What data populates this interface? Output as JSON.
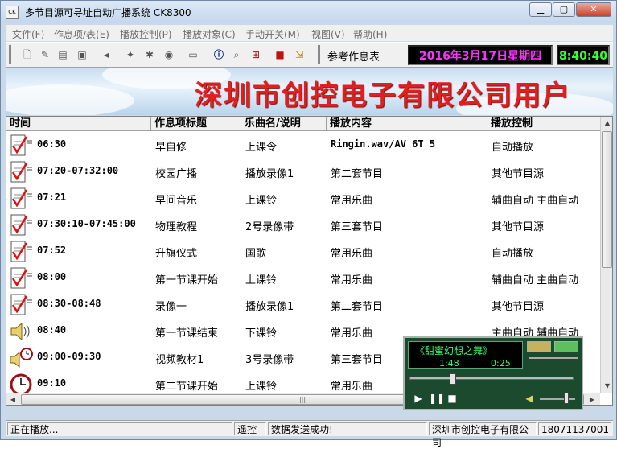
{
  "window": {
    "title": "多节目源可寻址自动广播系统 CK8300",
    "icon_text": "CK"
  },
  "menu": [
    "文件(F)",
    "作息项/表(E)",
    "播放控制(P)",
    "播放对象(C)",
    "手动开关(M)",
    "视图(V)",
    "帮助(H)"
  ],
  "toolbar": {
    "icons": [
      "new-file-icon",
      "edit-icon",
      "properties-icon",
      "save-icon",
      "mute-icon",
      "tool-icon",
      "settings-icon",
      "tape-icon",
      "keyboard-icon",
      "info-icon",
      "find-icon",
      "network-icon",
      "book-icon",
      "exit-icon"
    ],
    "schedule_label": "参考作息表",
    "date": "2016年3月17日星期四",
    "time": "8:40:40"
  },
  "banner": {
    "text": "深圳市创控电子有限公司用户",
    "bg_color": "#c8dff2",
    "text_color": "#e02020"
  },
  "table": {
    "headers": [
      "时间",
      "作息项标题",
      "乐曲名/说明",
      "播放内容",
      "播放控制"
    ],
    "rows": [
      {
        "icon": "schedule-check-icon",
        "time": "06:30",
        "title": "早自修",
        "music": "上课令",
        "content": "Ringin.wav/AV 6T 5",
        "control": "自动播放"
      },
      {
        "icon": "schedule-check-icon",
        "time": "07:20-07:32:00",
        "title": "校园广播",
        "music": "播放录像1",
        "content": "第二套节目",
        "control": "其他节目源"
      },
      {
        "icon": "schedule-check-icon",
        "time": "07:21",
        "title": "早间音乐",
        "music": "上课铃",
        "content": "常用乐曲",
        "control": "辅曲自动 主曲自动"
      },
      {
        "icon": "schedule-check-icon",
        "time": "07:30:10-07:45:00",
        "title": "物理教程",
        "music": "2号录像带",
        "content": "第三套节目",
        "control": "其他节目源"
      },
      {
        "icon": "schedule-check-icon",
        "time": "07:52",
        "title": "升旗仪式",
        "music": "国歌",
        "content": "常用乐曲",
        "control": "自动播放"
      },
      {
        "icon": "schedule-check-icon",
        "time": "08:00",
        "title": "第一节课开始",
        "music": "上课铃",
        "content": "常用乐曲",
        "control": "辅曲自动 主曲自动"
      },
      {
        "icon": "schedule-check-icon",
        "time": "08:30-08:48",
        "title": "录像一",
        "music": "播放录像1",
        "content": "第二套节目",
        "control": "其他节目源"
      },
      {
        "icon": "speaker-icon",
        "time": "08:40",
        "title": "第一节课结束",
        "music": "下课铃",
        "content": "常用乐曲",
        "control": "主曲自动 辅曲自动"
      },
      {
        "icon": "speaker-clock-icon",
        "time": "09:00-09:30",
        "title": "视频教材1",
        "music": "3号录像带",
        "content": "第三套节目",
        "control": ""
      },
      {
        "icon": "clock-icon",
        "time": "09:10",
        "title": "第二节课开始",
        "music": "上课铃",
        "content": "常用乐曲",
        "control": "动"
      }
    ]
  },
  "player": {
    "track": "《甜蜜幻想之舞》",
    "elapsed": "1:48",
    "remaining": "0:25",
    "progress": 0.25,
    "volume": 0.8
  },
  "status": {
    "state": "正在播放...",
    "mode": "遥控",
    "message": "数据发送成功!",
    "company": "深圳市创控电子有限公司",
    "phone": "18071137001"
  }
}
